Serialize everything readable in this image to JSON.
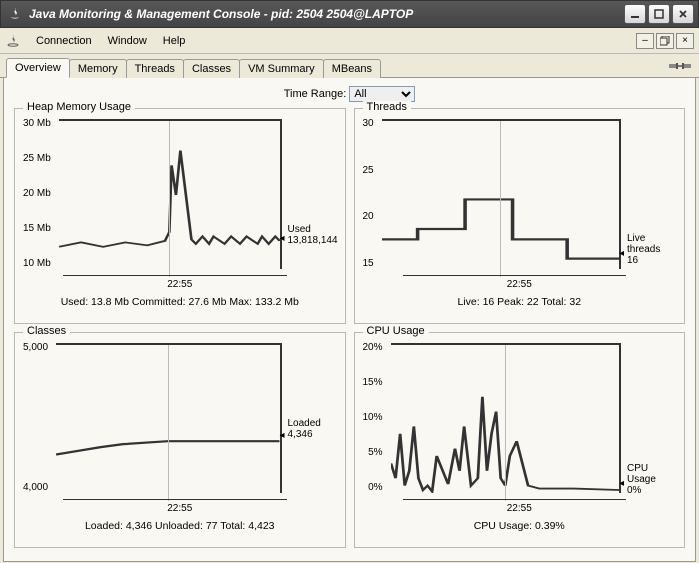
{
  "window": {
    "title": "Java Monitoring & Management Console - pid: 2504 2504@LAPTOP"
  },
  "menu": {
    "connection": "Connection",
    "window": "Window",
    "help": "Help"
  },
  "tabs": {
    "overview": "Overview",
    "memory": "Memory",
    "threads": "Threads",
    "classes": "Classes",
    "vmsummary": "VM Summary",
    "mbeans": "MBeans"
  },
  "time_range": {
    "label": "Time Range:",
    "value": "All"
  },
  "heap": {
    "title": "Heap Memory Usage",
    "yticks": [
      "30 Mb",
      "25 Mb",
      "20 Mb",
      "15 Mb",
      "10 Mb"
    ],
    "xlabel": "22:55",
    "legend_name": "Used",
    "legend_value": "13,818,144",
    "stats": "Used: 13.8 Mb    Committed: 27.6 Mb    Max: 133.2 Mb"
  },
  "threads": {
    "title": "Threads",
    "yticks": [
      "30",
      "25",
      "20",
      "15"
    ],
    "xlabel": "22:55",
    "legend_name": "Live threads",
    "legend_value": "16",
    "stats": "Live: 16    Peak: 22    Total: 32"
  },
  "classes": {
    "title": "Classes",
    "yticks": [
      "5,000",
      "4,000"
    ],
    "xlabel": "22:55",
    "legend_name": "Loaded",
    "legend_value": "4,346",
    "stats": "Loaded: 4,346    Unloaded: 77    Total: 4,423"
  },
  "cpu": {
    "title": "CPU Usage",
    "yticks": [
      "20%",
      "15%",
      "10%",
      "5%",
      "0%"
    ],
    "xlabel": "22:55",
    "legend_name": "CPU Usage",
    "legend_value": "0%",
    "stats": "CPU Usage: 0.39%"
  },
  "chart_data": [
    {
      "type": "line",
      "title": "Heap Memory Usage",
      "series": [
        {
          "name": "Used",
          "x": [
            0,
            10,
            20,
            30,
            40,
            48,
            50,
            51,
            53,
            55,
            60,
            62,
            65,
            68,
            70,
            75,
            78,
            82,
            85,
            90,
            92,
            95,
            98,
            100
          ],
          "y": [
            13,
            13.5,
            13,
            13.6,
            13.2,
            13.8,
            15,
            24,
            20,
            26,
            14,
            13.5,
            14.5,
            13.5,
            14.5,
            13.5,
            14.5,
            13.5,
            14.5,
            13.5,
            14.5,
            13.5,
            14.5,
            13.8
          ]
        }
      ],
      "ylim": [
        10,
        30
      ],
      "ylabel": "Mb",
      "xlabel": "22:55"
    },
    {
      "type": "line",
      "title": "Threads",
      "series": [
        {
          "name": "Live threads",
          "x": [
            0,
            15,
            15,
            35,
            35,
            55,
            55,
            78,
            78,
            100
          ],
          "y": [
            18,
            18,
            19,
            19,
            22,
            22,
            18,
            18,
            16,
            16
          ]
        }
      ],
      "ylim": [
        15,
        30
      ],
      "xlabel": "22:55"
    },
    {
      "type": "line",
      "title": "Classes",
      "series": [
        {
          "name": "Loaded",
          "x": [
            0,
            8,
            20,
            30,
            50,
            70,
            100
          ],
          "y": [
            4260,
            4280,
            4310,
            4330,
            4346,
            4346,
            4346
          ]
        }
      ],
      "ylim": [
        4000,
        5000
      ],
      "xlabel": "22:55"
    },
    {
      "type": "line",
      "title": "CPU Usage",
      "series": [
        {
          "name": "CPU Usage",
          "x": [
            0,
            2,
            4,
            6,
            8,
            10,
            12,
            14,
            16,
            18,
            20,
            25,
            28,
            30,
            32,
            35,
            38,
            40,
            42,
            44,
            46,
            48,
            50,
            52,
            55,
            60,
            65,
            80,
            100
          ],
          "y": [
            4,
            2,
            8,
            1,
            3,
            9,
            2,
            0,
            1,
            0,
            5,
            1,
            6,
            3,
            9,
            1,
            2,
            13,
            3,
            8,
            11,
            2,
            1,
            5,
            7,
            1,
            0.5,
            0.5,
            0.4
          ]
        }
      ],
      "ylim": [
        0,
        20
      ],
      "ylabel": "%",
      "xlabel": "22:55"
    }
  ]
}
